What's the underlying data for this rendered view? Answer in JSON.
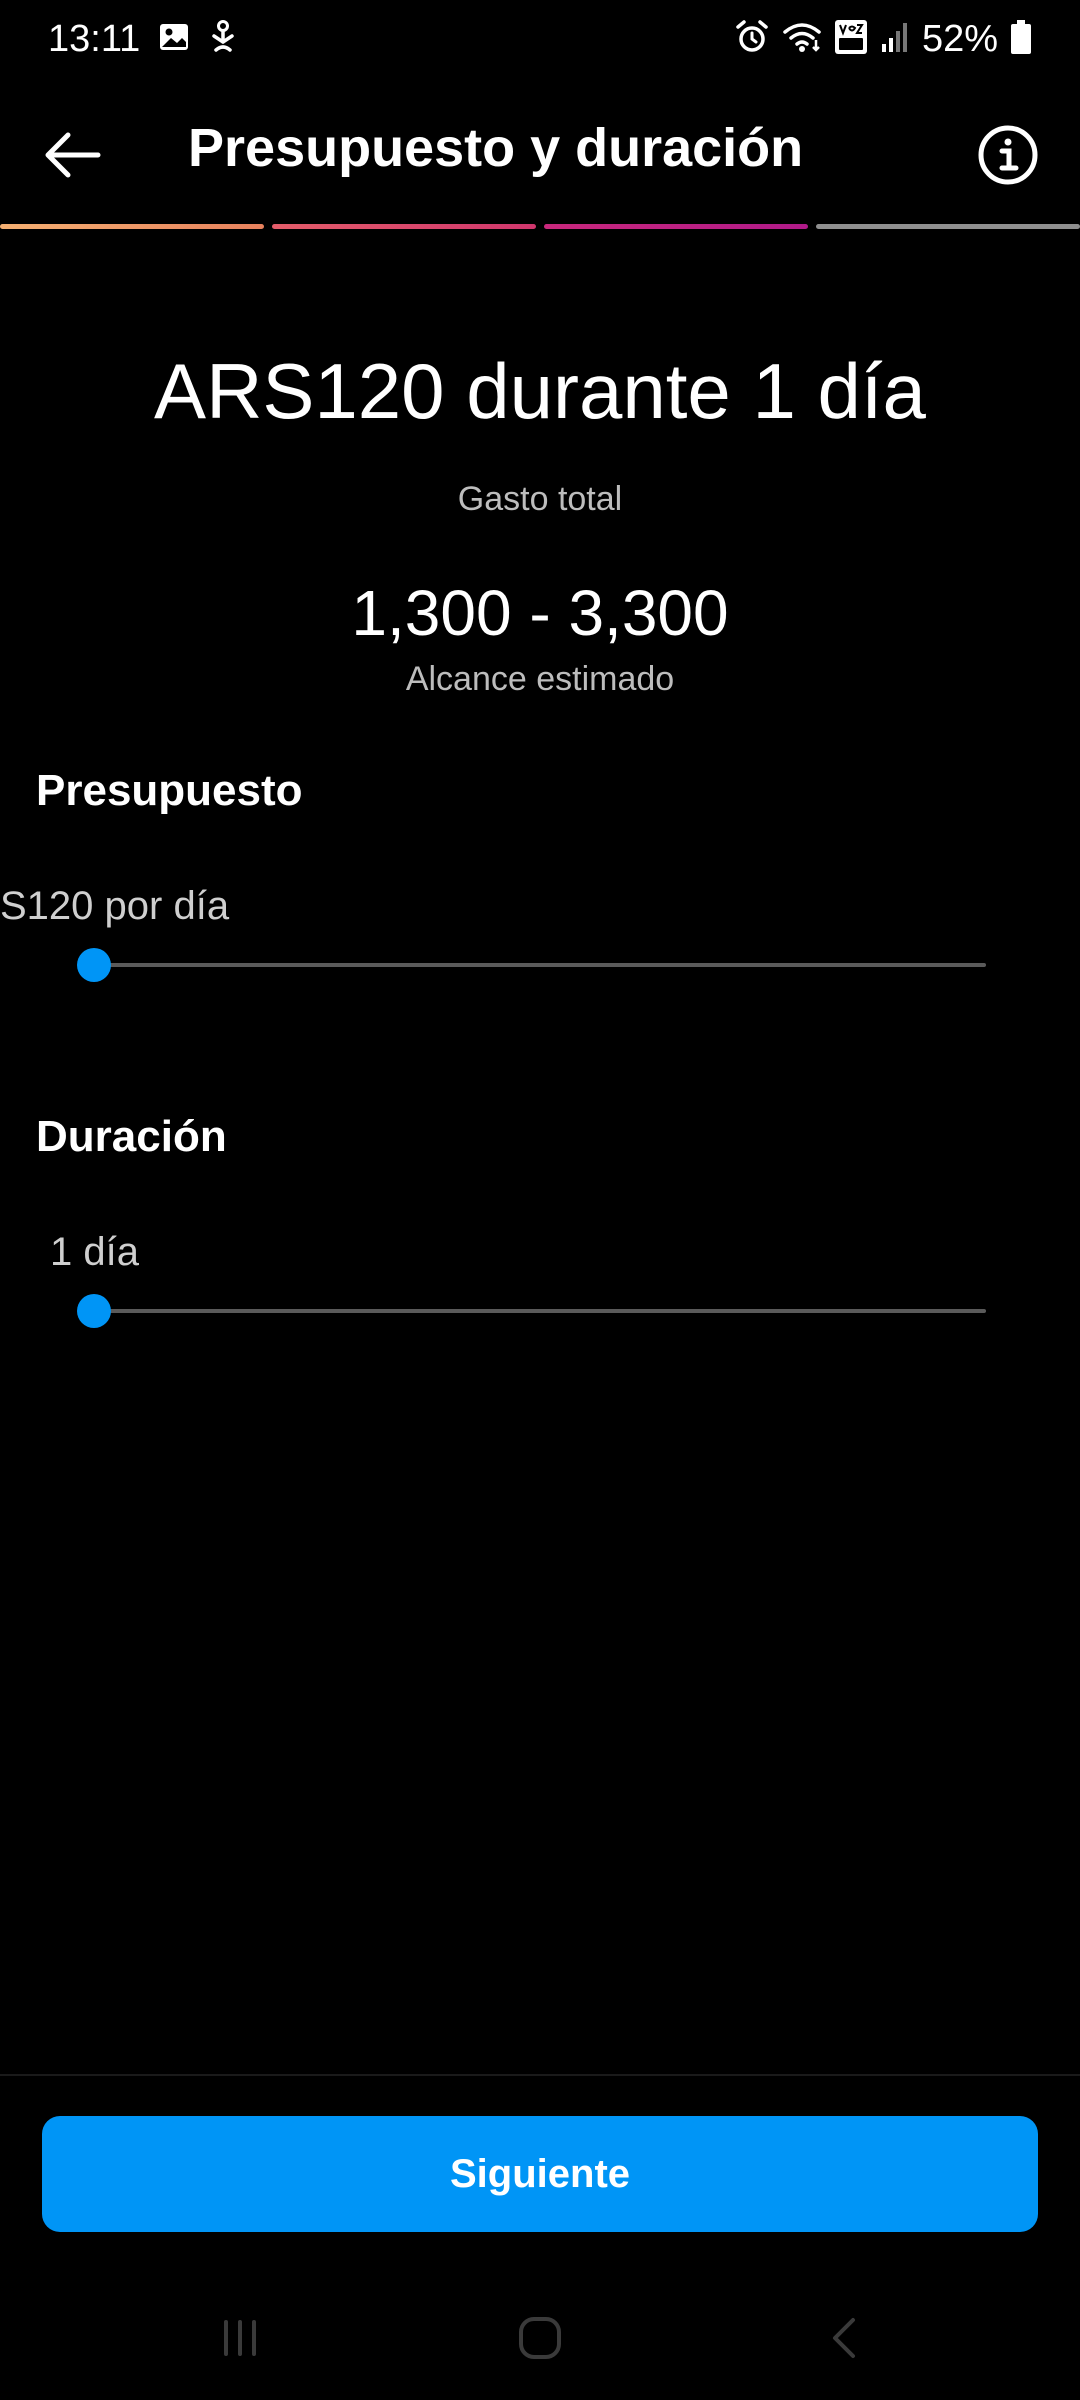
{
  "status_bar": {
    "time": "13:11",
    "battery": "52%",
    "left_icons": [
      "image-icon",
      "notification-icon"
    ],
    "right_icons": [
      "alarm-icon",
      "wifi-icon",
      "volte-4g-icon",
      "signal-icon",
      "battery-icon"
    ]
  },
  "header": {
    "title": "Presupuesto y duración",
    "back_icon": "arrow-left-icon",
    "info_icon": "info-icon"
  },
  "progress": {
    "total_steps": 4,
    "completed_steps": 3
  },
  "summary": {
    "title": "ARS120 durante 1 día",
    "subtitle": "Gasto total",
    "reach_value": "1,300 - 3,300",
    "reach_label": "Alcance estimado"
  },
  "budget": {
    "heading": "Presupuesto",
    "value_label": "S120 por día",
    "slider_fraction": 0
  },
  "duration": {
    "heading": "Duración",
    "value_label": "1 día",
    "slider_fraction": 0
  },
  "footer": {
    "next_label": "Siguiente"
  },
  "colors": {
    "accent": "#0095f6",
    "background": "#000000",
    "muted_text": "#bdbdbd"
  },
  "nav": {
    "items": [
      "recent-apps-icon",
      "home-icon",
      "back-nav-icon"
    ]
  }
}
